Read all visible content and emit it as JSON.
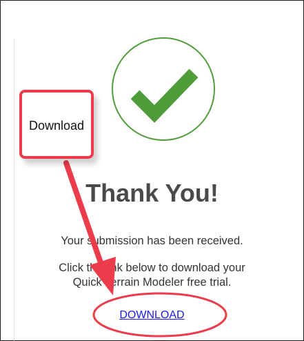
{
  "page": {
    "title": "Thank You!",
    "received_text": "Your submission has been received.",
    "instructions_line1": "Click the link below to download your",
    "instructions_line2": "Quick Terrain Modeler free trial.",
    "download_link": "DOWNLOAD"
  },
  "annotation": {
    "callout_label": "Download"
  },
  "colors": {
    "check_green": "#4f9d3a",
    "annotation_red": "#ec3c4c",
    "link_blue": "#1a1aee",
    "title_gray": "#4a4a4a"
  },
  "icons": {
    "success": "check-mark-icon"
  }
}
